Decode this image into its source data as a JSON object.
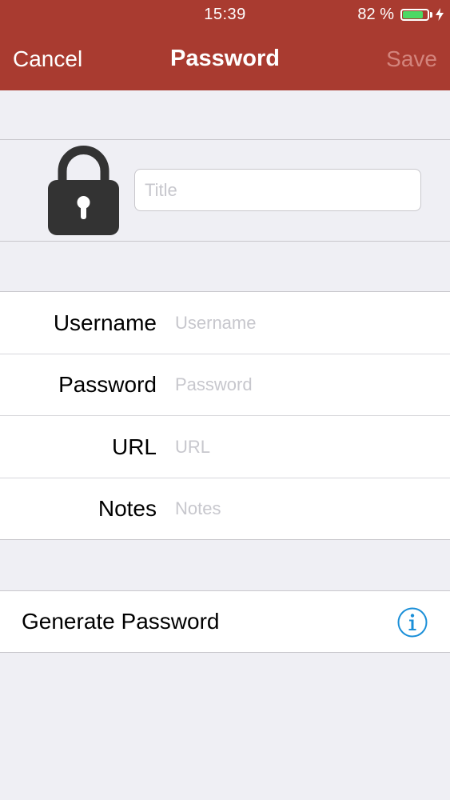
{
  "status_bar": {
    "time": "15:39",
    "battery_text": "82 %",
    "battery_level": 0.82,
    "charging": true
  },
  "nav": {
    "cancel_label": "Cancel",
    "title": "Password",
    "save_label": "Save"
  },
  "title_field": {
    "placeholder": "Title",
    "value": ""
  },
  "fields": [
    {
      "label": "Username",
      "placeholder": "Username",
      "value": ""
    },
    {
      "label": "Password",
      "placeholder": "Password",
      "value": ""
    },
    {
      "label": "URL",
      "placeholder": "URL",
      "value": ""
    },
    {
      "label": "Notes",
      "placeholder": "Notes",
      "value": ""
    }
  ],
  "generate": {
    "label": "Generate Password"
  },
  "icons": {
    "lock": "lock-icon",
    "info": "info-icon",
    "battery": "battery-icon",
    "charging": "charging-bolt-icon"
  },
  "colors": {
    "nav_background": "#a93b30",
    "save_disabled": "#d3847c",
    "info_blue": "#1a8fd8",
    "battery_green": "#4cd964"
  }
}
